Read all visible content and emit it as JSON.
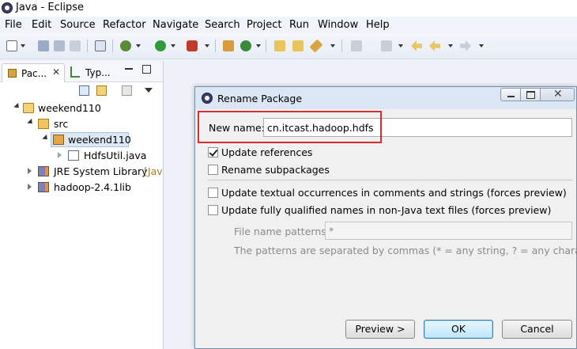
{
  "window": {
    "title": "Java - Eclipse"
  },
  "menu": [
    "File",
    "Edit",
    "Source",
    "Refactor",
    "Navigate",
    "Search",
    "Project",
    "Run",
    "Window",
    "Help"
  ],
  "views": {
    "package_explorer_tab": "Pac...",
    "type_hierarchy_tab": "Typ..."
  },
  "tree": [
    {
      "label": "weekend110",
      "icon": "project-icon"
    },
    {
      "label": "src",
      "icon": "source-folder-icon"
    },
    {
      "label": "weekend110",
      "icon": "package-icon",
      "selected": true
    },
    {
      "label": "HdfsUtil.java",
      "icon": "java-file-icon"
    },
    {
      "label": "JRE System Library",
      "suffix": "[Jav",
      "icon": "library-icon"
    },
    {
      "label": "hadoop-2.4.1lib",
      "icon": "library-icon"
    }
  ],
  "dialog": {
    "title": "Rename Package",
    "new_name_label": "New name:",
    "new_name_value": "cn.itcast.hadoop.hdfs",
    "options": {
      "update_references": {
        "label": "Update references",
        "checked": true
      },
      "rename_subpackages": {
        "label": "Rename subpackages",
        "checked": false
      },
      "update_textual": {
        "label": "Update textual occurrences in comments and strings (forces preview)",
        "checked": false
      },
      "update_qualified": {
        "label": "Update fully qualified names in non-Java text files (forces preview)",
        "checked": false
      }
    },
    "file_patterns_label": "File name patterns:",
    "file_patterns_value": "*",
    "patterns_hint": "The patterns are separated by commas (* = any string, ? = any character)",
    "buttons": {
      "preview": "Preview >",
      "ok": "OK",
      "cancel": "Cancel"
    }
  },
  "colors": {
    "highlight": "#d32f2f",
    "selection": "#dde8f7",
    "ok_border": "#3c7fb1"
  }
}
